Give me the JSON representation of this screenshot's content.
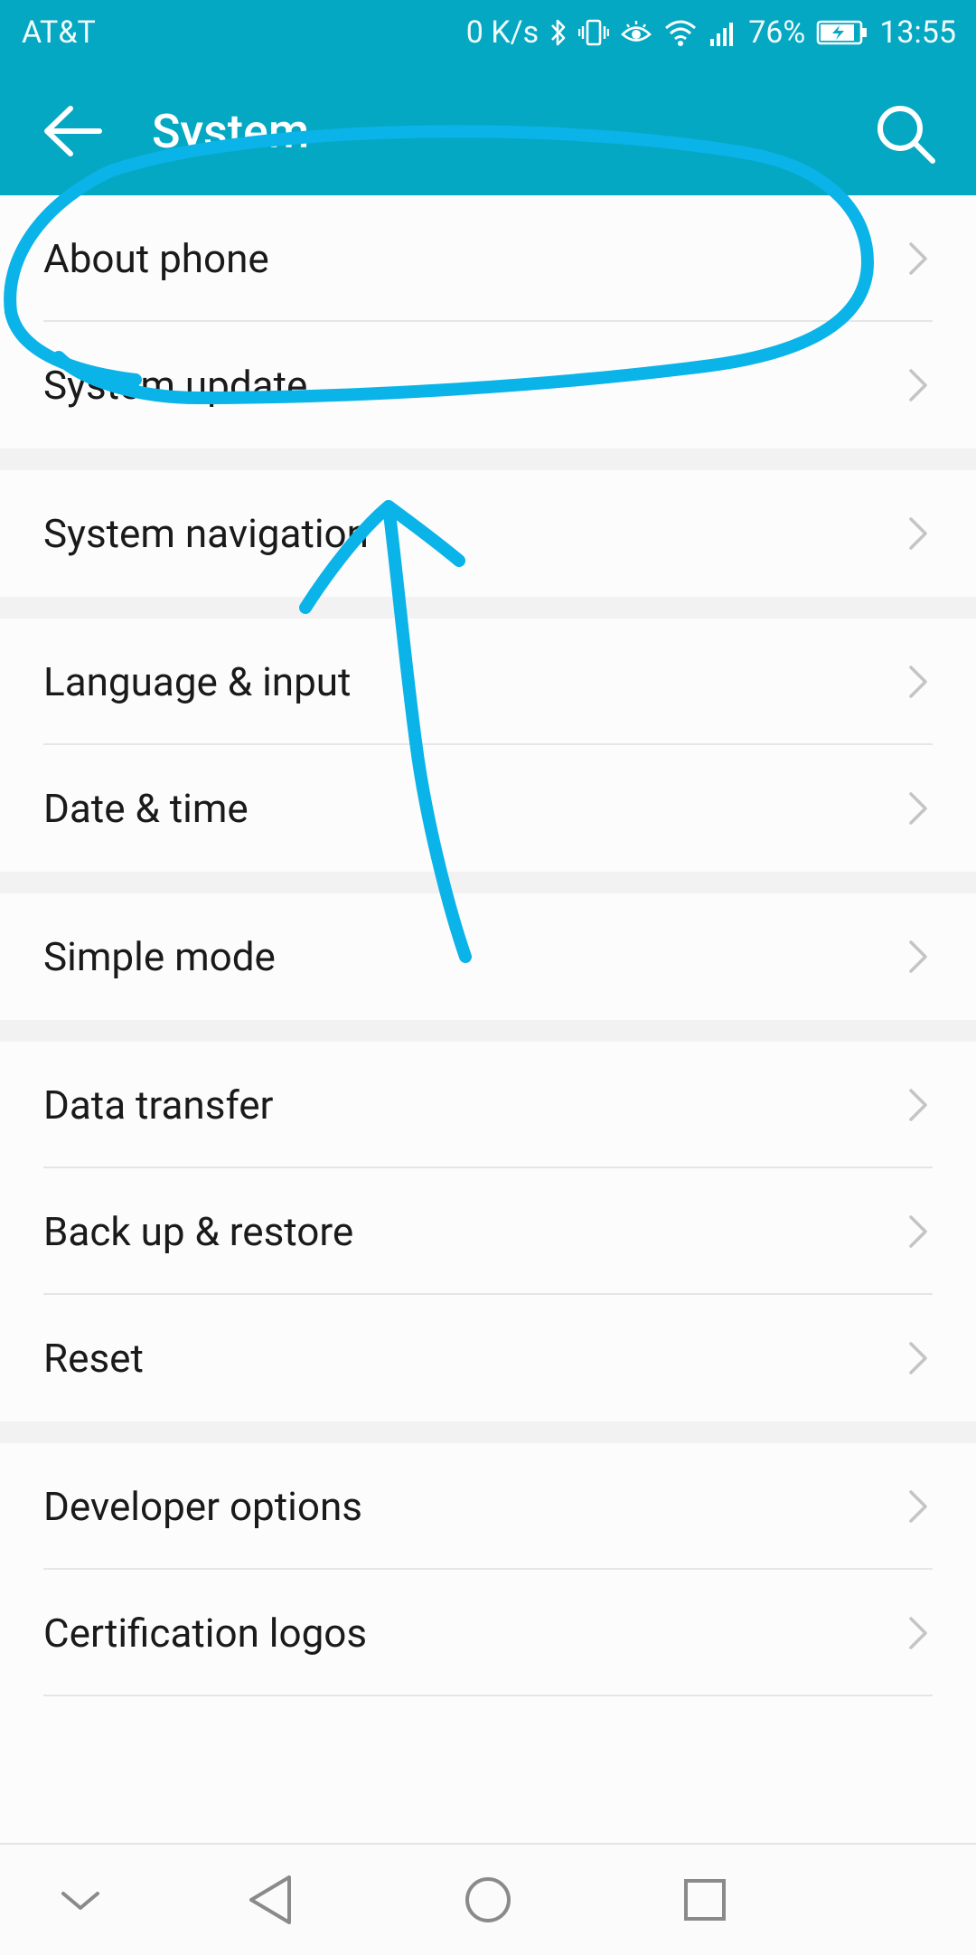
{
  "status_bar": {
    "carrier": "AT&T",
    "network_speed": "0 K/s",
    "battery_percent": "76%",
    "time": "13:55",
    "icons": [
      "bluetooth-icon",
      "vibrate-icon",
      "eye-comfort-icon",
      "wifi-icon",
      "signal-icon",
      "battery-charging-icon"
    ]
  },
  "toolbar": {
    "title": "System",
    "back_icon": "arrow-left-icon",
    "search_icon": "search-icon"
  },
  "groups": [
    {
      "items": [
        {
          "label": "About phone"
        },
        {
          "label": "System update"
        }
      ]
    },
    {
      "items": [
        {
          "label": "System navigation"
        }
      ]
    },
    {
      "items": [
        {
          "label": "Language & input"
        },
        {
          "label": "Date & time"
        }
      ]
    },
    {
      "items": [
        {
          "label": "Simple mode"
        }
      ]
    },
    {
      "items": [
        {
          "label": "Data transfer"
        },
        {
          "label": "Back up & restore"
        },
        {
          "label": "Reset"
        }
      ]
    },
    {
      "items": [
        {
          "label": "Developer options"
        },
        {
          "label": "Certification logos"
        }
      ]
    }
  ],
  "nav_bar": {
    "buttons": [
      "chevron-down-icon",
      "back-triangle-icon",
      "home-circle-icon",
      "recents-square-icon"
    ]
  },
  "colors": {
    "accent": "#04a8c3",
    "annotation": "#0ab3e8",
    "text": "#1a1a1a"
  }
}
